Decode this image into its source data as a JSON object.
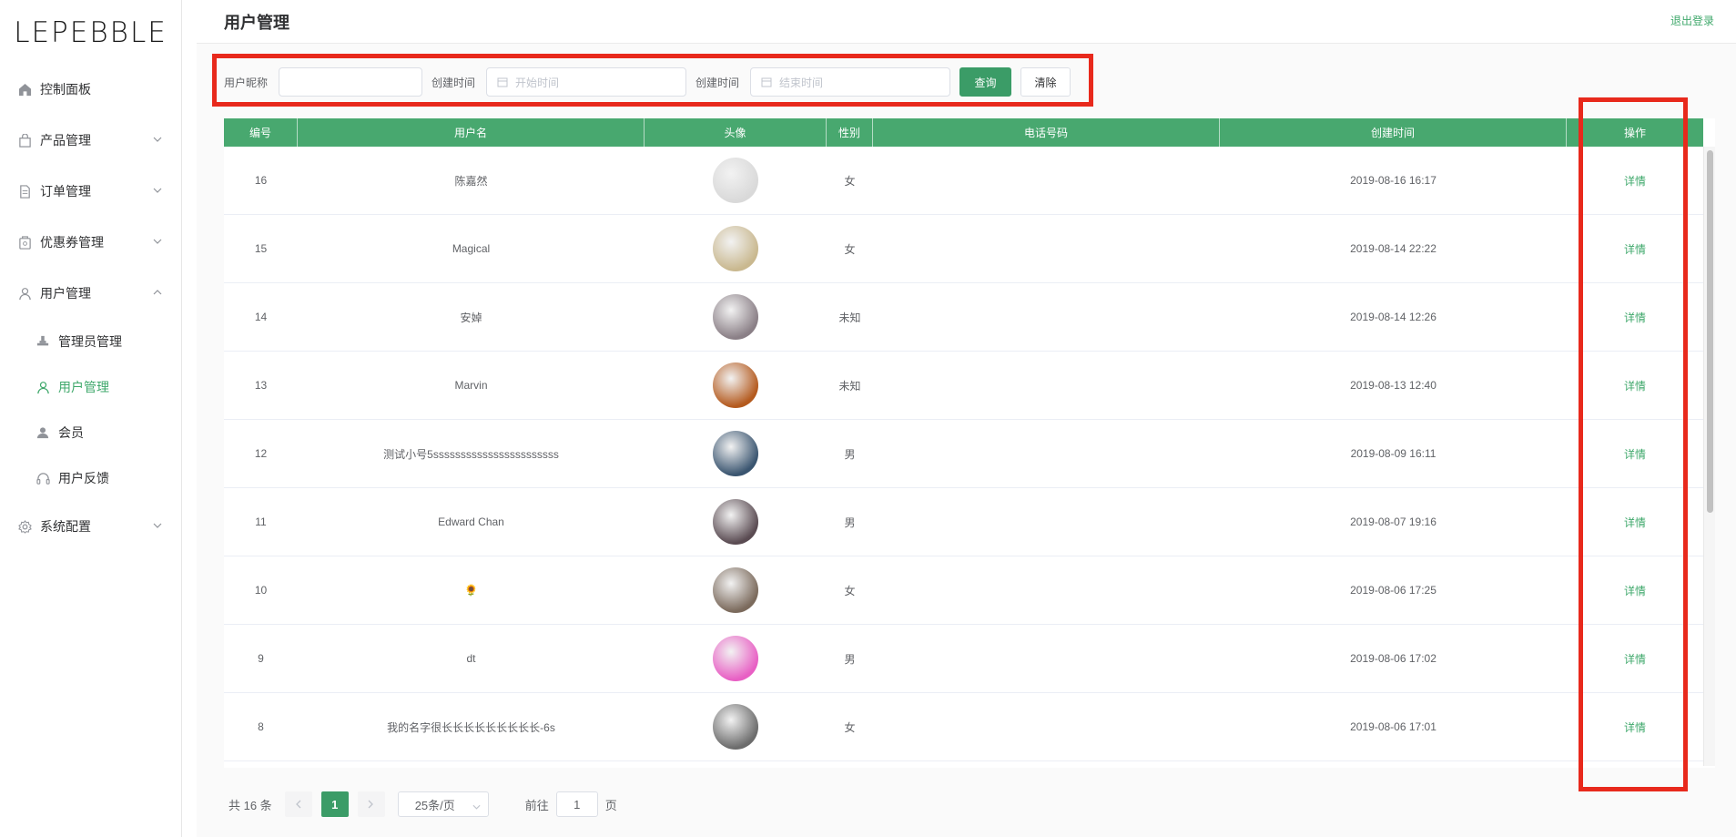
{
  "brand": {
    "logo": "LEPEBBLE"
  },
  "sidebar": {
    "items": [
      {
        "label": "控制面板",
        "icon": "home-icon"
      },
      {
        "label": "产品管理",
        "icon": "bag-icon"
      },
      {
        "label": "订单管理",
        "icon": "document-icon"
      },
      {
        "label": "优惠券管理",
        "icon": "coupon-icon"
      },
      {
        "label": "用户管理",
        "icon": "user-icon"
      },
      {
        "label": "系统配置",
        "icon": "gear-icon"
      }
    ],
    "subitems": [
      {
        "label": "管理员管理",
        "icon": "admin-icon"
      },
      {
        "label": "用户管理",
        "icon": "user-outline-icon"
      },
      {
        "label": "会员",
        "icon": "member-icon"
      },
      {
        "label": "用户反馈",
        "icon": "headset-icon"
      }
    ]
  },
  "header": {
    "title": "用户管理",
    "logout": "退出登录"
  },
  "filter": {
    "nickname_label": "用户昵称",
    "nickname_value": "",
    "created_label_1": "创建时间",
    "start_placeholder": "开始时间",
    "created_label_2": "创建时间",
    "end_placeholder": "结束时间",
    "query_button": "查询",
    "clear_button": "清除"
  },
  "table": {
    "columns": [
      "编号",
      "用户名",
      "头像",
      "性别",
      "电话号码",
      "创建时间",
      "操作"
    ],
    "rows": [
      {
        "id": "16",
        "name": "陈嘉然",
        "gender": "女",
        "phone": "",
        "created": "2019-08-16 16:17",
        "action": "详情",
        "avatar_color": "#d9d9d9"
      },
      {
        "id": "15",
        "name": "Magical",
        "gender": "女",
        "phone": "",
        "created": "2019-08-14 22:22",
        "action": "详情",
        "avatar_color": "#c9b88f"
      },
      {
        "id": "14",
        "name": "安婥",
        "gender": "未知",
        "phone": "",
        "created": "2019-08-14 12:26",
        "action": "详情",
        "avatar_color": "#8a7f86"
      },
      {
        "id": "13",
        "name": "Marvin",
        "gender": "未知",
        "phone": "",
        "created": "2019-08-13 12:40",
        "action": "详情",
        "avatar_color": "#b45a1e"
      },
      {
        "id": "12",
        "name": "测试小号5sssssssssssssssssssssss",
        "gender": "男",
        "phone": "",
        "created": "2019-08-09 16:11",
        "action": "详情",
        "avatar_color": "#3a5570"
      },
      {
        "id": "11",
        "name": "Edward Chan",
        "gender": "男",
        "phone": "",
        "created": "2019-08-07 19:16",
        "action": "详情",
        "avatar_color": "#5a4b52"
      },
      {
        "id": "10",
        "name": "🌻",
        "gender": "女",
        "phone": "",
        "created": "2019-08-06 17:25",
        "action": "详情",
        "avatar_color": "#7b6a5c"
      },
      {
        "id": "9",
        "name": "dt",
        "gender": "男",
        "phone": "",
        "created": "2019-08-06 17:02",
        "action": "详情",
        "avatar_color": "#e85fc4"
      },
      {
        "id": "8",
        "name": "我的名字很长长长长长长长长长-6s",
        "gender": "女",
        "phone": "",
        "created": "2019-08-06 17:01",
        "action": "详情",
        "avatar_color": "#6c6c6c"
      }
    ]
  },
  "pagination": {
    "total": "共 16 条",
    "current": "1",
    "page_size": "25条/页",
    "goto_label": "前往",
    "goto_value": "1",
    "page_suffix": "页"
  }
}
